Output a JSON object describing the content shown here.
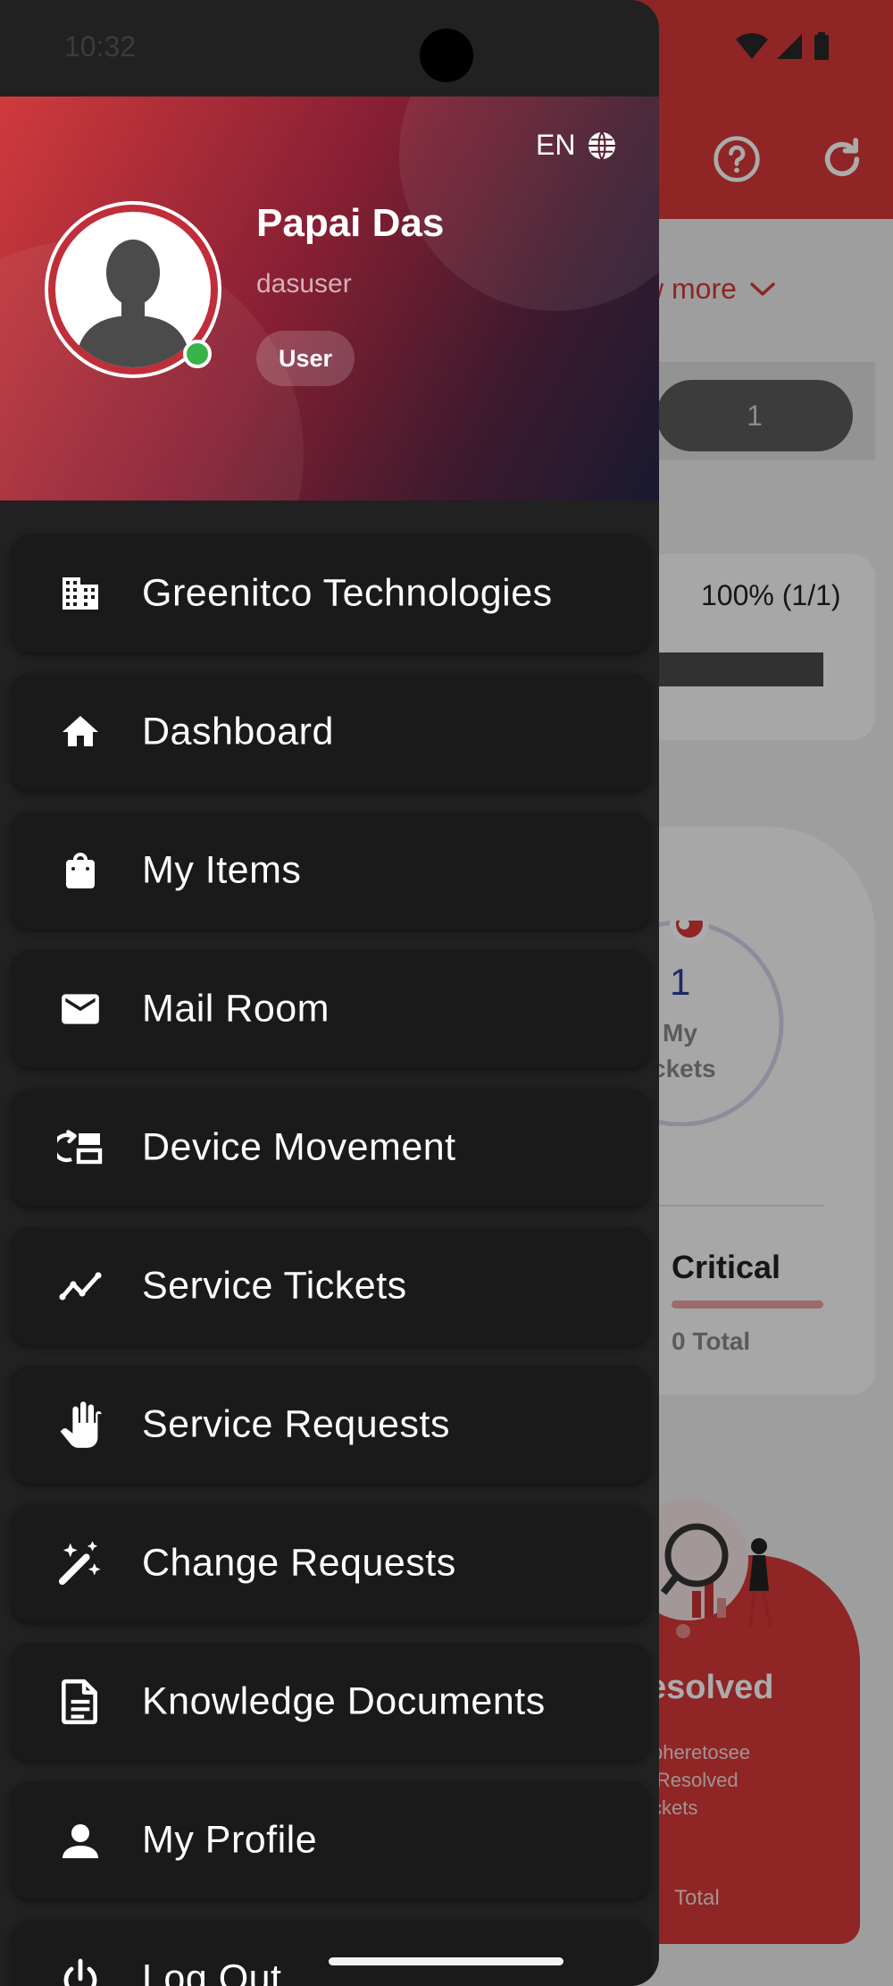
{
  "status_bar": {
    "time": "10:32"
  },
  "drawer_header": {
    "language": "EN",
    "user_name": "Papai Das",
    "username": "dasuser",
    "role": "User",
    "online": true
  },
  "menu": {
    "items": [
      {
        "label": "Greenitco Technologies",
        "icon": "building-icon"
      },
      {
        "label": "Dashboard",
        "icon": "home-icon"
      },
      {
        "label": "My Items",
        "icon": "shopping-bag-icon"
      },
      {
        "label": "Mail Room",
        "icon": "mail-icon"
      },
      {
        "label": "Device Movement",
        "icon": "device-movement-icon"
      },
      {
        "label": "Service Tickets",
        "icon": "trending-icon"
      },
      {
        "label": "Service Requests",
        "icon": "hand-icon"
      },
      {
        "label": "Change Requests",
        "icon": "magic-wand-icon"
      },
      {
        "label": "Knowledge Documents",
        "icon": "document-icon"
      },
      {
        "label": "My Profile",
        "icon": "person-icon"
      },
      {
        "label": "Log Out",
        "icon": "power-icon"
      }
    ]
  },
  "background_screen": {
    "show_more_label": "w more",
    "count_pill": "1",
    "progress_text": "100% (1/1)",
    "progress_fraction": 1.0,
    "tickets_count": "1",
    "tickets_label_line1": "My",
    "tickets_label_line2": "ckets",
    "critical_label": "Critical",
    "critical_total": "0 Total",
    "resolved_label": "esolved",
    "resolved_desc_lines": [
      "pheretosee",
      "lResolved",
      "ckets"
    ],
    "resolved_total": "Total"
  },
  "colors": {
    "brand_red": "#d63838",
    "drawer_bg": "#212121",
    "menu_item_bg": "#1a1a1a",
    "online_green": "#38b34a"
  }
}
